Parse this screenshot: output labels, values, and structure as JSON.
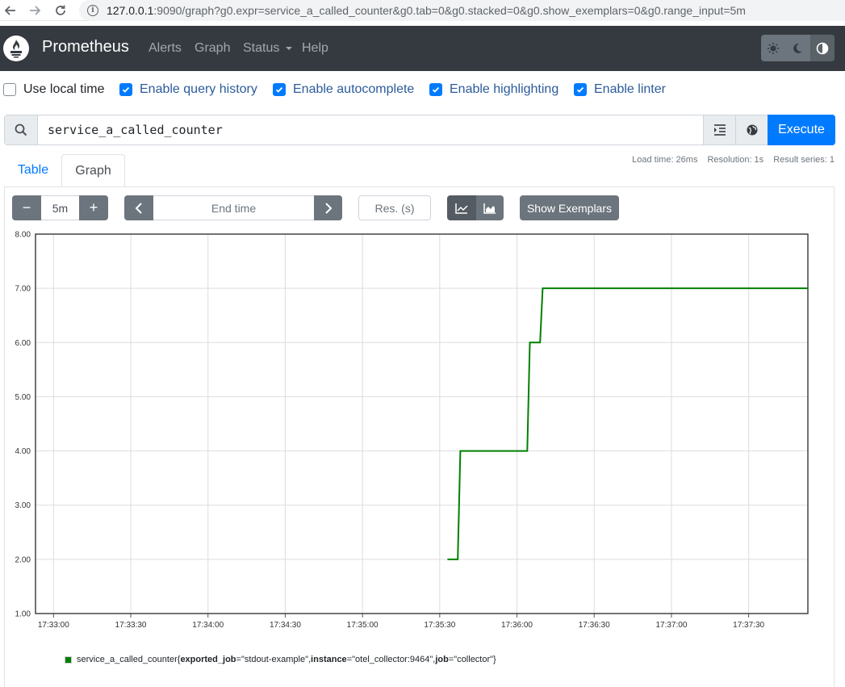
{
  "browser": {
    "url_host": "127.0.0.1",
    "url_path": ":9090/graph?g0.expr=service_a_called_counter&g0.tab=0&g0.stacked=0&g0.show_exemplars=0&g0.range_input=5m"
  },
  "navbar": {
    "brand": "Prometheus",
    "links": [
      "Alerts",
      "Graph",
      "Status",
      "Help"
    ]
  },
  "options": [
    {
      "label": "Use local time",
      "checked": false
    },
    {
      "label": "Enable query history",
      "checked": true
    },
    {
      "label": "Enable autocomplete",
      "checked": true
    },
    {
      "label": "Enable highlighting",
      "checked": true
    },
    {
      "label": "Enable linter",
      "checked": true
    }
  ],
  "query": {
    "expression": "service_a_called_counter",
    "execute_label": "Execute"
  },
  "tabs": [
    "Table",
    "Graph"
  ],
  "stats": {
    "load_time": "Load time: 26ms",
    "resolution": "Resolution: 1s",
    "result_series": "Result series: 1"
  },
  "graph_controls": {
    "range": "5m",
    "minus": "−",
    "plus": "+",
    "end_time_placeholder": "End time",
    "resolution_placeholder": "Res. (s)",
    "show_exemplars": "Show Exemplars"
  },
  "colors": {
    "series": "#008000",
    "primary": "#007bff",
    "navbar": "#343a40",
    "secondary": "#6c757d"
  },
  "chart_data": {
    "type": "line",
    "x_tick_labels": [
      "17:33:00",
      "17:33:30",
      "17:34:00",
      "17:34:30",
      "17:35:00",
      "17:35:30",
      "17:36:00",
      "17:36:30",
      "17:37:00",
      "17:37:30"
    ],
    "y_tick_labels": [
      "1.00",
      "2.00",
      "3.00",
      "4.00",
      "5.00",
      "6.00",
      "7.00",
      "8.00"
    ],
    "xlim": [
      "17:32:53",
      "17:37:53"
    ],
    "ylim": [
      1,
      8
    ],
    "grid": true,
    "legend_position": "bottom",
    "series": [
      {
        "metric": "service_a_called_counter",
        "labels": [
          {
            "key": "exported_job",
            "value": "stdout-example"
          },
          {
            "key": "instance",
            "value": "otel_collector:9464"
          },
          {
            "key": "job",
            "value": "collector"
          }
        ],
        "points": [
          [
            "17:35:33",
            2
          ],
          [
            "17:35:37",
            2
          ],
          [
            "17:35:38",
            4
          ],
          [
            "17:36:04",
            4
          ],
          [
            "17:36:05",
            6
          ],
          [
            "17:36:09",
            6
          ],
          [
            "17:36:10",
            7
          ],
          [
            "17:37:53",
            7
          ]
        ]
      }
    ]
  }
}
